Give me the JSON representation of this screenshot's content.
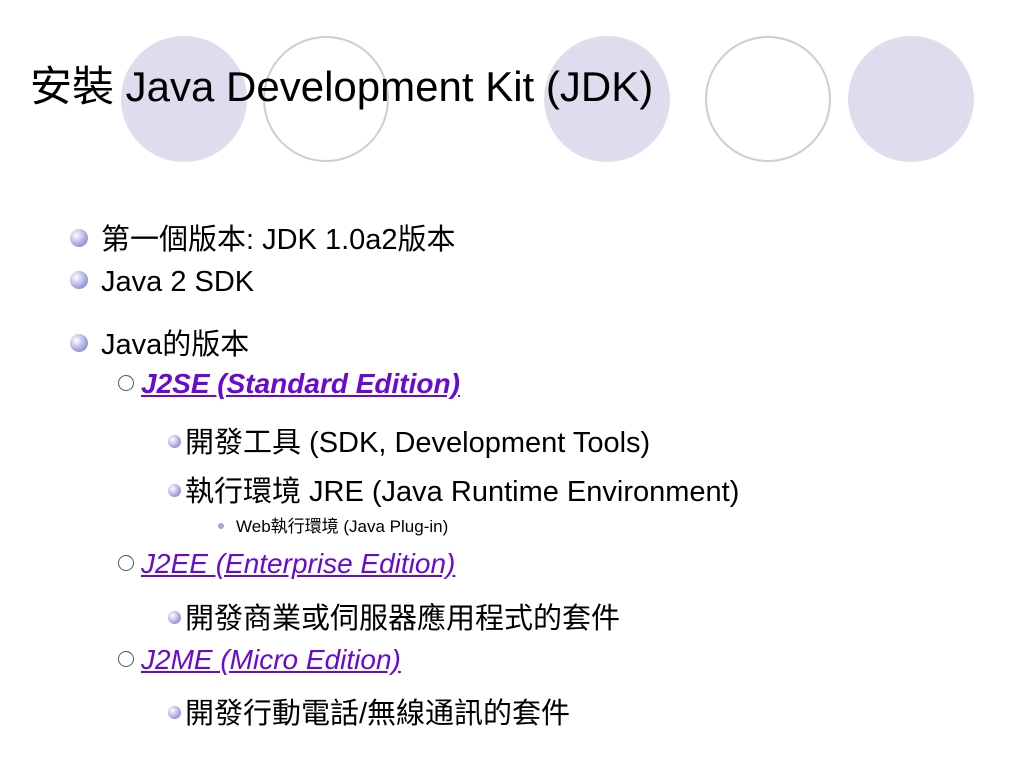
{
  "theme": {
    "accent": "#6d6dbd",
    "link_color": "#6a0ad0",
    "decor_fill": "#ddddee",
    "decor_ring": "#ccccdd"
  },
  "title": "安裝 Java Development Kit (JDK)",
  "bullets": [
    {
      "text": "第一個版本: JDK 1.0a2版本"
    },
    {
      "text": "Java 2 SDK"
    },
    {
      "text": "Java的版本"
    },
    {
      "text": "J2SE (Standard Edition)"
    },
    {
      "text": "開發工具 (SDK, Development Tools)"
    },
    {
      "text": "執行環境 JRE (Java Runtime Environment)"
    },
    {
      "text": "Web執行環境 (Java Plug-in)"
    },
    {
      "text": "J2EE (Enterprise Edition)"
    },
    {
      "text": "開發商業或伺服器應用程式的套件"
    },
    {
      "text": "J2ME (Micro Edition)"
    },
    {
      "text": "開發行動電話/無線通訊的套件"
    }
  ]
}
